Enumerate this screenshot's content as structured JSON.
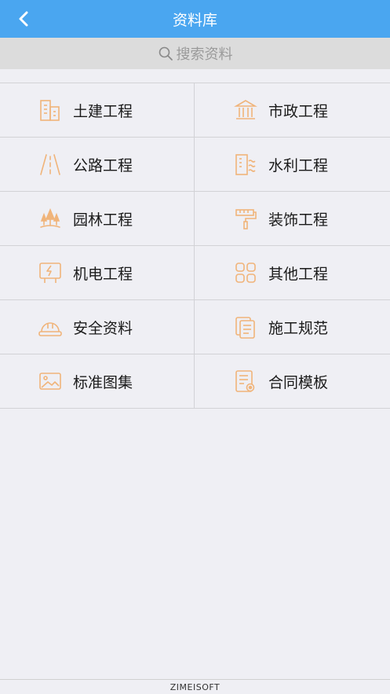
{
  "header": {
    "title": "资料库",
    "back_icon": "chevron-left-icon",
    "background": "#4aa6f0"
  },
  "search": {
    "placeholder": "搜索资料",
    "icon": "search-icon"
  },
  "categories": [
    {
      "label": "土建工程",
      "icon": "building-icon"
    },
    {
      "label": "市政工程",
      "icon": "government-building-icon"
    },
    {
      "label": "公路工程",
      "icon": "road-icon"
    },
    {
      "label": "水利工程",
      "icon": "water-building-icon"
    },
    {
      "label": "园林工程",
      "icon": "trees-icon"
    },
    {
      "label": "装饰工程",
      "icon": "paint-roller-icon"
    },
    {
      "label": "机电工程",
      "icon": "electric-board-icon"
    },
    {
      "label": "其他工程",
      "icon": "grid-icon"
    },
    {
      "label": "安全资料",
      "icon": "safety-helmet-icon"
    },
    {
      "label": "施工规范",
      "icon": "documents-icon"
    },
    {
      "label": "标准图集",
      "icon": "image-icon"
    },
    {
      "label": "合同模板",
      "icon": "contract-icon"
    }
  ],
  "icon_color": "#f0b47a",
  "footer": {
    "text": "ZIMEISOFT"
  }
}
